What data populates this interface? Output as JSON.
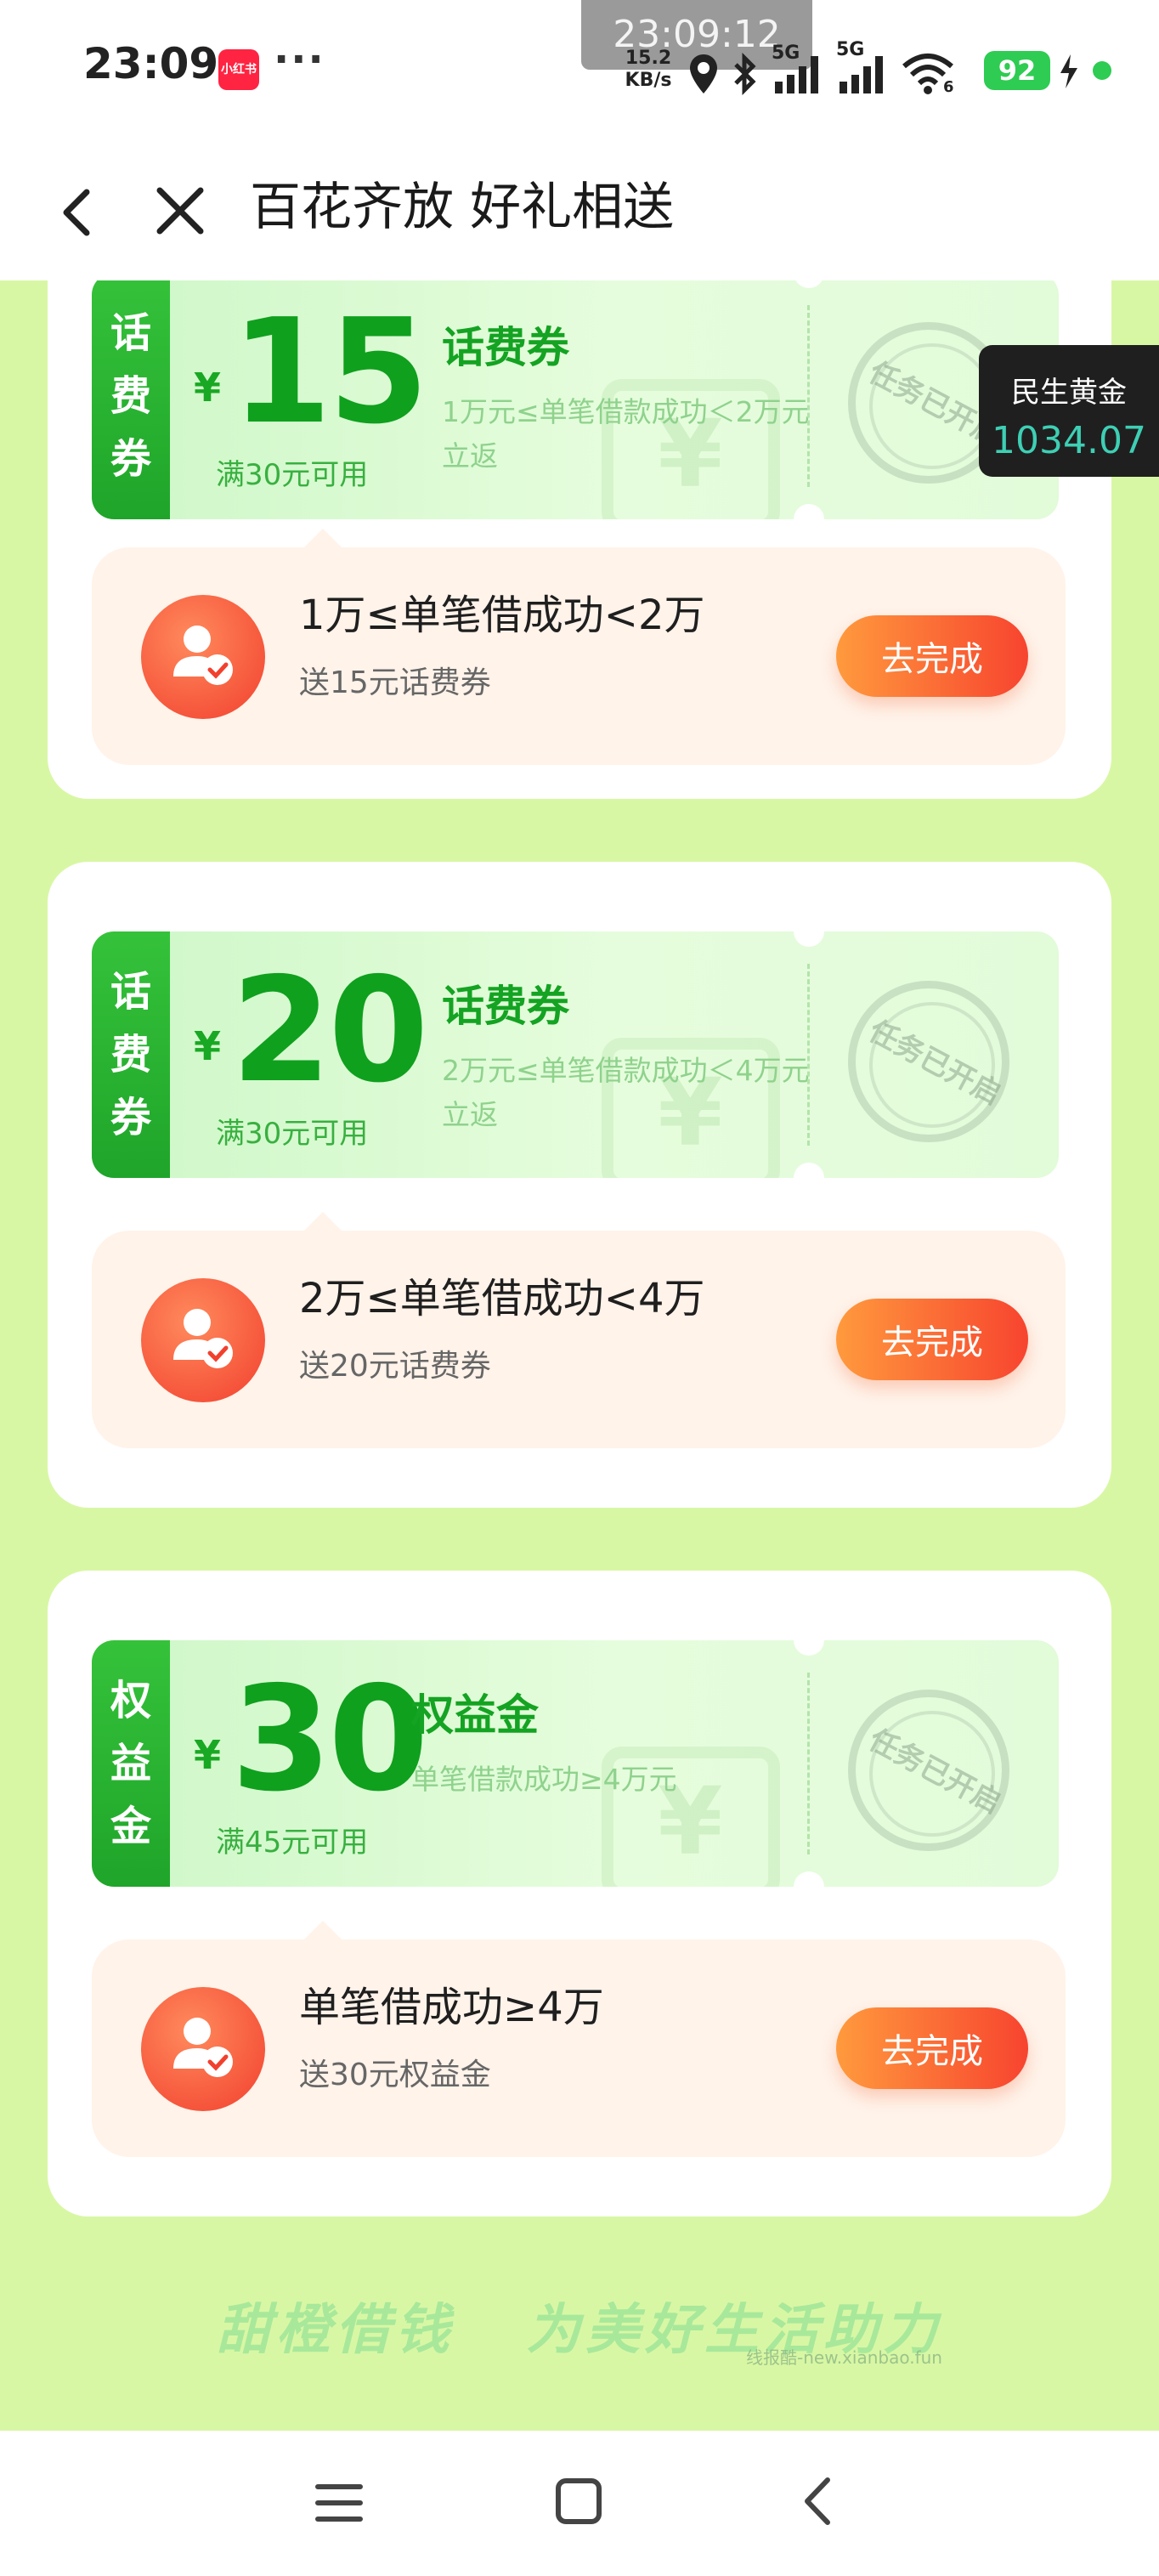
{
  "status_bar": {
    "time": "23:09",
    "app_badge": "小红书",
    "more": "···",
    "overlay_time": "23:09:12",
    "net_speed_value": "15.2",
    "net_speed_unit": "KB/s",
    "signal1_label": "5G",
    "signal2_label": "5G",
    "wifi_label": "6",
    "battery": "92"
  },
  "nav": {
    "title": "百花齐放 好礼相送"
  },
  "gold_badge": {
    "title": "民生黄金",
    "value": "1034.07"
  },
  "rewards": [
    {
      "coupon": {
        "tab_chars": [
          "话",
          "费",
          "券"
        ],
        "currency": "¥",
        "amount": "15",
        "condition": "满30元可用",
        "name": "话费券",
        "desc": "1万元≤单笔借款成功＜2万元立返",
        "stamp": "任务已开启"
      },
      "task": {
        "title": "1万≤单笔借成功<2万",
        "subtitle": "送15元话费券",
        "button": "去完成"
      }
    },
    {
      "coupon": {
        "tab_chars": [
          "话",
          "费",
          "券"
        ],
        "currency": "¥",
        "amount": "20",
        "condition": "满30元可用",
        "name": "话费券",
        "desc": "2万元≤单笔借款成功＜4万元立返",
        "stamp": "任务已开启"
      },
      "task": {
        "title": "2万≤单笔借成功<4万",
        "subtitle": "送20元话费券",
        "button": "去完成"
      }
    },
    {
      "coupon": {
        "tab_chars": [
          "权",
          "益",
          "金"
        ],
        "currency": "¥",
        "amount": "30",
        "condition": "满45元可用",
        "name": "权益金",
        "desc": "单笔借款成功≥4万元",
        "stamp": "任务已开启"
      },
      "task": {
        "title": "单笔借成功≥4万",
        "subtitle": "送30元权益金",
        "button": "去完成"
      }
    }
  ],
  "slogan": {
    "part1": "甜橙借钱",
    "part2": "为美好生活助力"
  },
  "watermark": "线报酷-new.xianbao.fun",
  "colors": {
    "page_bg": "#d8f7a4",
    "coupon_green": "#1fa52a",
    "button_orange": "#f7442f",
    "task_bg": "#fff3ea"
  }
}
